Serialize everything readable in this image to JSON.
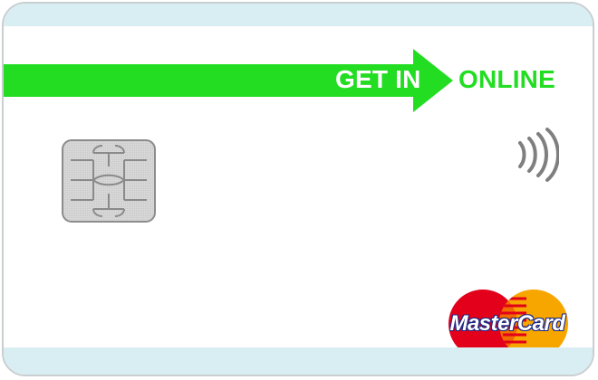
{
  "card": {
    "brand_slogan_part1": "GET IN",
    "brand_slogan_part2": "ONLINE",
    "network_brand": "MasterCard",
    "colors": {
      "accent_green": "#22dd22",
      "strip_blue": "#d9eef2",
      "border_gray": "#c9ced1",
      "chip_gray": "#d8d8d8",
      "mc_red": "#e2001a",
      "mc_yellow": "#f7a600",
      "contactless_gray": "#7f7f7f"
    },
    "icons": {
      "chip": "emv-chip-icon",
      "contactless": "contactless-icon",
      "network": "mastercard-logo"
    }
  }
}
